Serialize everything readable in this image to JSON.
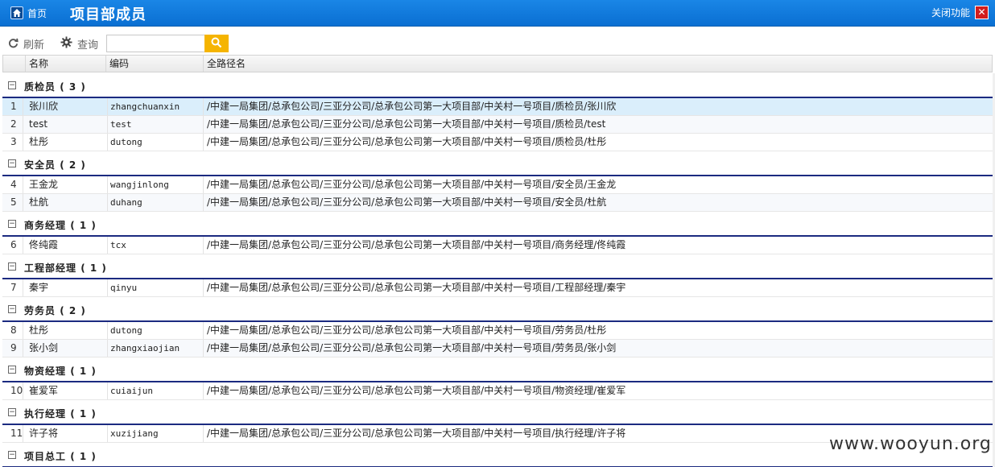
{
  "header": {
    "home_label": "首页",
    "title": "项目部成员",
    "close_label": "关闭功能",
    "close_glyph": "✕"
  },
  "toolbar": {
    "refresh_label": "刷新",
    "query_label": "查询",
    "search_value": "",
    "search_placeholder": ""
  },
  "columns": {
    "name": "名称",
    "code": "编码",
    "path": "全路径名"
  },
  "groups": [
    {
      "name": "质检员",
      "count": "( 3 )",
      "rows": [
        {
          "num": "1",
          "name": "张川欣",
          "code": "zhangchuanxin",
          "path": "/中建一局集团/总承包公司/三亚分公司/总承包公司第一大项目部/中关村一号项目/质检员/张川欣"
        },
        {
          "num": "2",
          "name": "test",
          "code": "test",
          "path": "/中建一局集团/总承包公司/三亚分公司/总承包公司第一大项目部/中关村一号项目/质检员/test"
        },
        {
          "num": "3",
          "name": "杜彤",
          "code": "dutong",
          "path": "/中建一局集团/总承包公司/三亚分公司/总承包公司第一大项目部/中关村一号项目/质检员/杜彤"
        }
      ]
    },
    {
      "name": "安全员",
      "count": "( 2 )",
      "rows": [
        {
          "num": "4",
          "name": "王金龙",
          "code": "wangjinlong",
          "path": "/中建一局集团/总承包公司/三亚分公司/总承包公司第一大项目部/中关村一号项目/安全员/王金龙"
        },
        {
          "num": "5",
          "name": "杜航",
          "code": "duhang",
          "path": "/中建一局集团/总承包公司/三亚分公司/总承包公司第一大项目部/中关村一号项目/安全员/杜航"
        }
      ]
    },
    {
      "name": "商务经理",
      "count": "( 1 )",
      "rows": [
        {
          "num": "6",
          "name": "佟纯霞",
          "code": "tcx",
          "path": "/中建一局集团/总承包公司/三亚分公司/总承包公司第一大项目部/中关村一号项目/商务经理/佟纯霞"
        }
      ]
    },
    {
      "name": "工程部经理",
      "count": "( 1 )",
      "rows": [
        {
          "num": "7",
          "name": "秦宇",
          "code": "qinyu",
          "path": "/中建一局集团/总承包公司/三亚分公司/总承包公司第一大项目部/中关村一号项目/工程部经理/秦宇"
        }
      ]
    },
    {
      "name": "劳务员",
      "count": "( 2 )",
      "rows": [
        {
          "num": "8",
          "name": "杜彤",
          "code": "dutong",
          "path": "/中建一局集团/总承包公司/三亚分公司/总承包公司第一大项目部/中关村一号项目/劳务员/杜彤"
        },
        {
          "num": "9",
          "name": "张小剑",
          "code": "zhangxiaojian",
          "path": "/中建一局集团/总承包公司/三亚分公司/总承包公司第一大项目部/中关村一号项目/劳务员/张小剑"
        }
      ]
    },
    {
      "name": "物资经理",
      "count": "( 1 )",
      "rows": [
        {
          "num": "10",
          "name": "崔爱军",
          "code": "cuiaijun",
          "path": "/中建一局集团/总承包公司/三亚分公司/总承包公司第一大项目部/中关村一号项目/物资经理/崔爱军"
        }
      ]
    },
    {
      "name": "执行经理",
      "count": "( 1 )",
      "rows": [
        {
          "num": "11",
          "name": "许子将",
          "code": "xuzijiang",
          "path": "/中建一局集团/总承包公司/三亚分公司/总承包公司第一大项目部/中关村一号项目/执行经理/许子将"
        }
      ]
    },
    {
      "name": "项目总工",
      "count": "( 1 )",
      "rows": []
    }
  ],
  "selected_row": "1",
  "watermark": "www.wooyun.org"
}
